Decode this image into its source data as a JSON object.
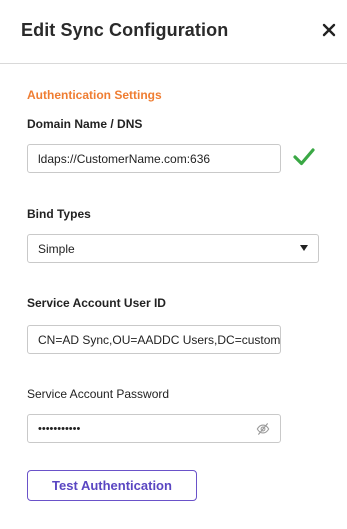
{
  "header": {
    "title": "Edit Sync Configuration",
    "close_icon": "close-icon"
  },
  "section": {
    "title": "Authentication Settings"
  },
  "domain": {
    "label": "Domain Name / DNS",
    "value": "ldaps://CustomerName.com:636",
    "status_icon": "checkmark-icon",
    "status_color": "#3aa845"
  },
  "bind_types": {
    "label": "Bind Types",
    "selected": "Simple",
    "icon": "dropdown-caret-icon"
  },
  "service_user": {
    "label": "Service Account User ID",
    "value": "CN=AD Sync,OU=AADDC Users,DC=custom"
  },
  "service_password": {
    "label": "Service Account Password",
    "masked_value": "•••••••••••",
    "icon": "eye-slash-icon"
  },
  "actions": {
    "test_label": "Test Authentication"
  },
  "colors": {
    "accent_orange": "#ef7d32",
    "button_purple": "#5a46c2",
    "success_green": "#3aa845"
  }
}
